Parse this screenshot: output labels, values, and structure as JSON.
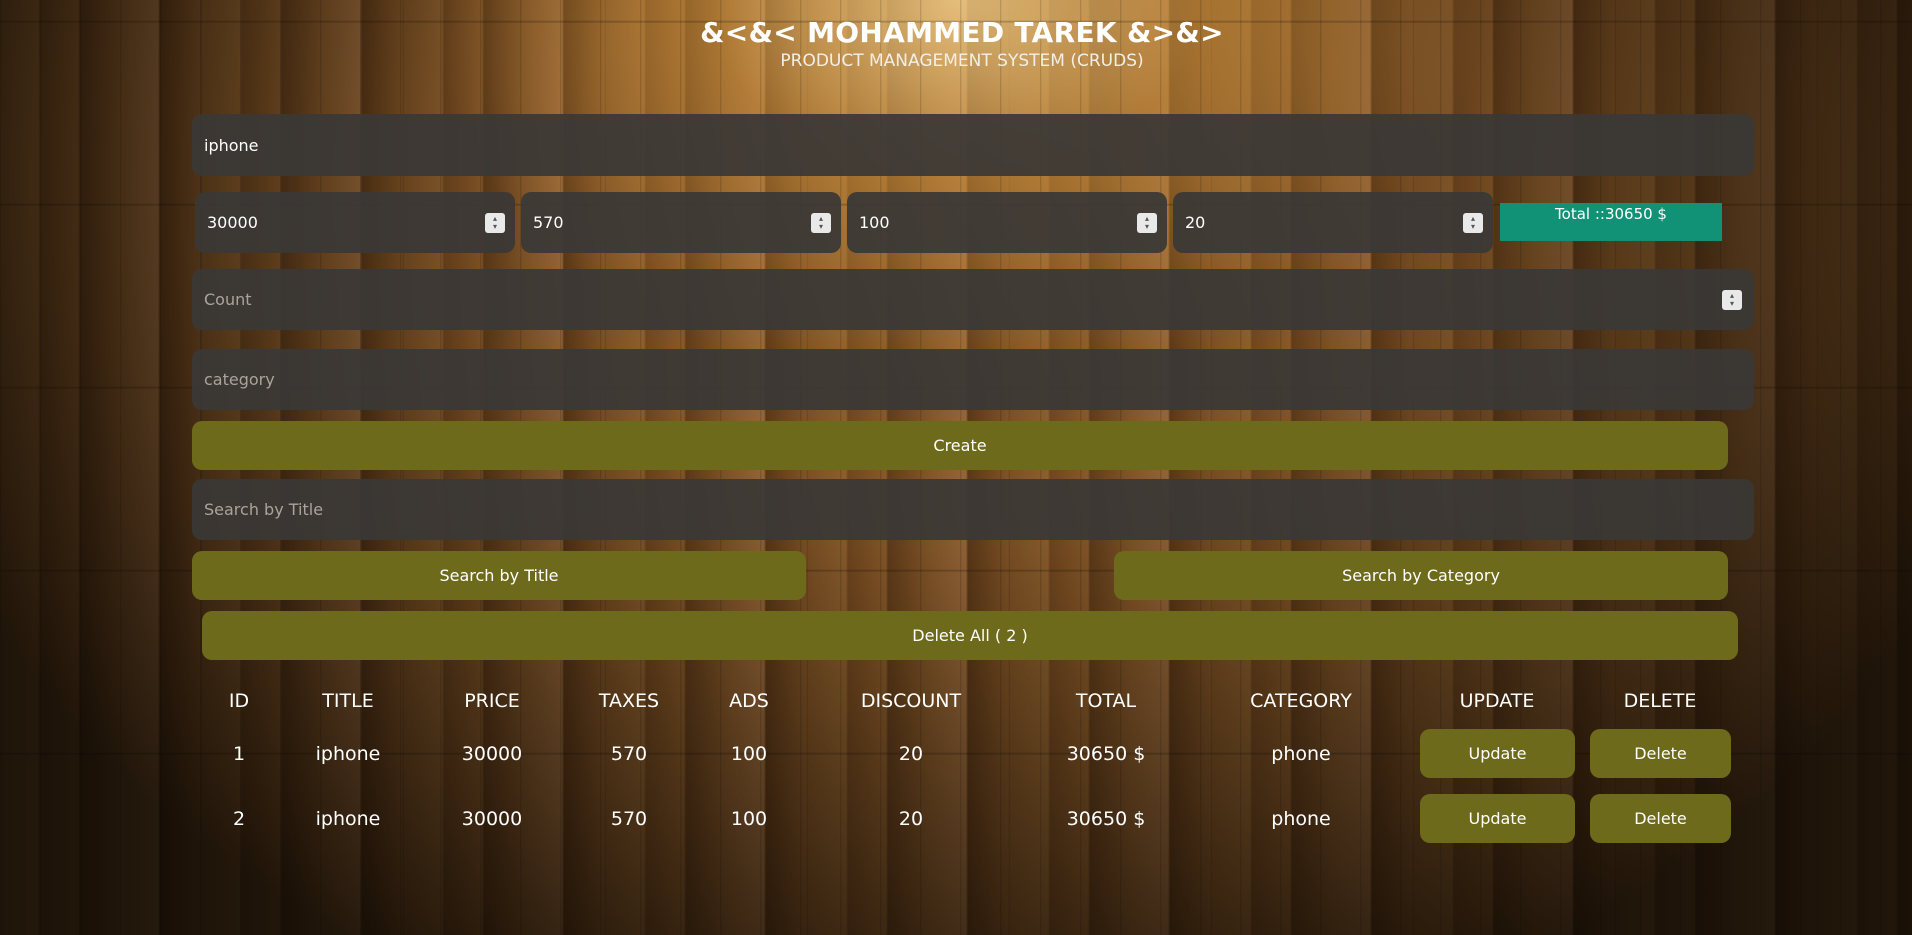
{
  "header": {
    "title": "&<&< MOHAMMED TAREK &>&>",
    "subtitle": "PRODUCT MANAGEMENT SYSTEM (CRUDS)"
  },
  "form": {
    "title_value": "iphone",
    "price_value": "30000",
    "taxes_value": "570",
    "ads_value": "100",
    "discount_value": "20",
    "total_label": "Total ::30650 $",
    "count_placeholder": "Count",
    "category_placeholder": "category",
    "create_label": "Create",
    "search_placeholder": "Search by Title",
    "search_title_label": "Search by Title",
    "search_category_label": "Search by Category",
    "delete_all_label": "Delete All ( 2 )"
  },
  "colors": {
    "button": "#6e6a1c",
    "total": "#119175",
    "field": "#3a3836"
  },
  "table": {
    "headers": [
      "ID",
      "TITLE",
      "PRICE",
      "TAXES",
      "ADS",
      "DISCOUNT",
      "TOTAL",
      "CATEGORY",
      "UPDATE",
      "DELETE"
    ],
    "rows": [
      {
        "id": "1",
        "title": "iphone",
        "price": "30000",
        "taxes": "570",
        "ads": "100",
        "discount": "20",
        "total": "30650 $",
        "category": "phone",
        "update": "Update",
        "delete": "Delete"
      },
      {
        "id": "2",
        "title": "iphone",
        "price": "30000",
        "taxes": "570",
        "ads": "100",
        "discount": "20",
        "total": "30650 $",
        "category": "phone",
        "update": "Update",
        "delete": "Delete"
      }
    ]
  }
}
